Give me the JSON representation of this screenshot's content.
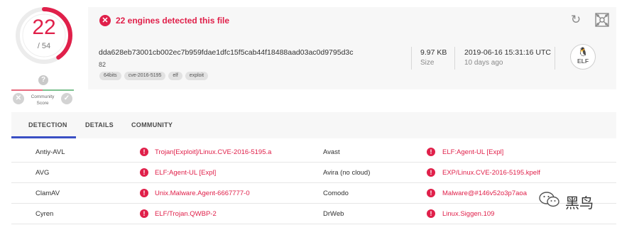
{
  "score": {
    "detected": "22",
    "total": "/ 54",
    "detected_count": 22,
    "total_count": 54,
    "ring_color": "#e0204a",
    "help_icon": "?",
    "community_label": "Community Score",
    "vote_down_icon": "x-circle-icon",
    "vote_up_icon": "check-circle-icon"
  },
  "header": {
    "alert_text": "22 engines detected this file",
    "alert_color": "#e0204a",
    "alert_icon": "x-circle-icon",
    "hash": "dda628eb73001cb002ec7b959fdae1dfc15f5cab44f18488aad03ac0d9795d3c",
    "file_name": "82",
    "tags": [
      "64bits",
      "cve-2016-5195",
      "elf",
      "exploit"
    ],
    "size_value": "9.97 KB",
    "size_label": "Size",
    "date_value": "2019-06-16 15:31:16 UTC",
    "date_label": "10 days ago",
    "file_type_icon": "elf-file-icon",
    "file_type_label": "ELF",
    "reload_icon": "reload-icon",
    "graph_icon": "graph-icon"
  },
  "tabs": [
    {
      "label": "DETECTION",
      "active": true
    },
    {
      "label": "DETAILS",
      "active": false
    },
    {
      "label": "COMMUNITY",
      "active": false
    }
  ],
  "detections": [
    {
      "engine_left": "Antiy-AVL",
      "result_left": "Trojan[Exploit]/Linux.CVE-2016-5195.a",
      "engine_right": "Avast",
      "result_right": "ELF:Agent-UL [Expl]"
    },
    {
      "engine_left": "AVG",
      "result_left": "ELF:Agent-UL [Expl]",
      "engine_right": "Avira (no cloud)",
      "result_right": "EXP/Linux.CVE-2016-5195.kpelf"
    },
    {
      "engine_left": "ClamAV",
      "result_left": "Unix.Malware.Agent-6667777-0",
      "engine_right": "Comodo",
      "result_right": "Malware@#146v52o3p7aoa"
    },
    {
      "engine_left": "Cyren",
      "result_left": "ELF/Trojan.QWBP-2",
      "engine_right": "DrWeb",
      "result_right": "Linux.Siggen.109"
    }
  ],
  "watermark": {
    "text": "黑鸟"
  }
}
